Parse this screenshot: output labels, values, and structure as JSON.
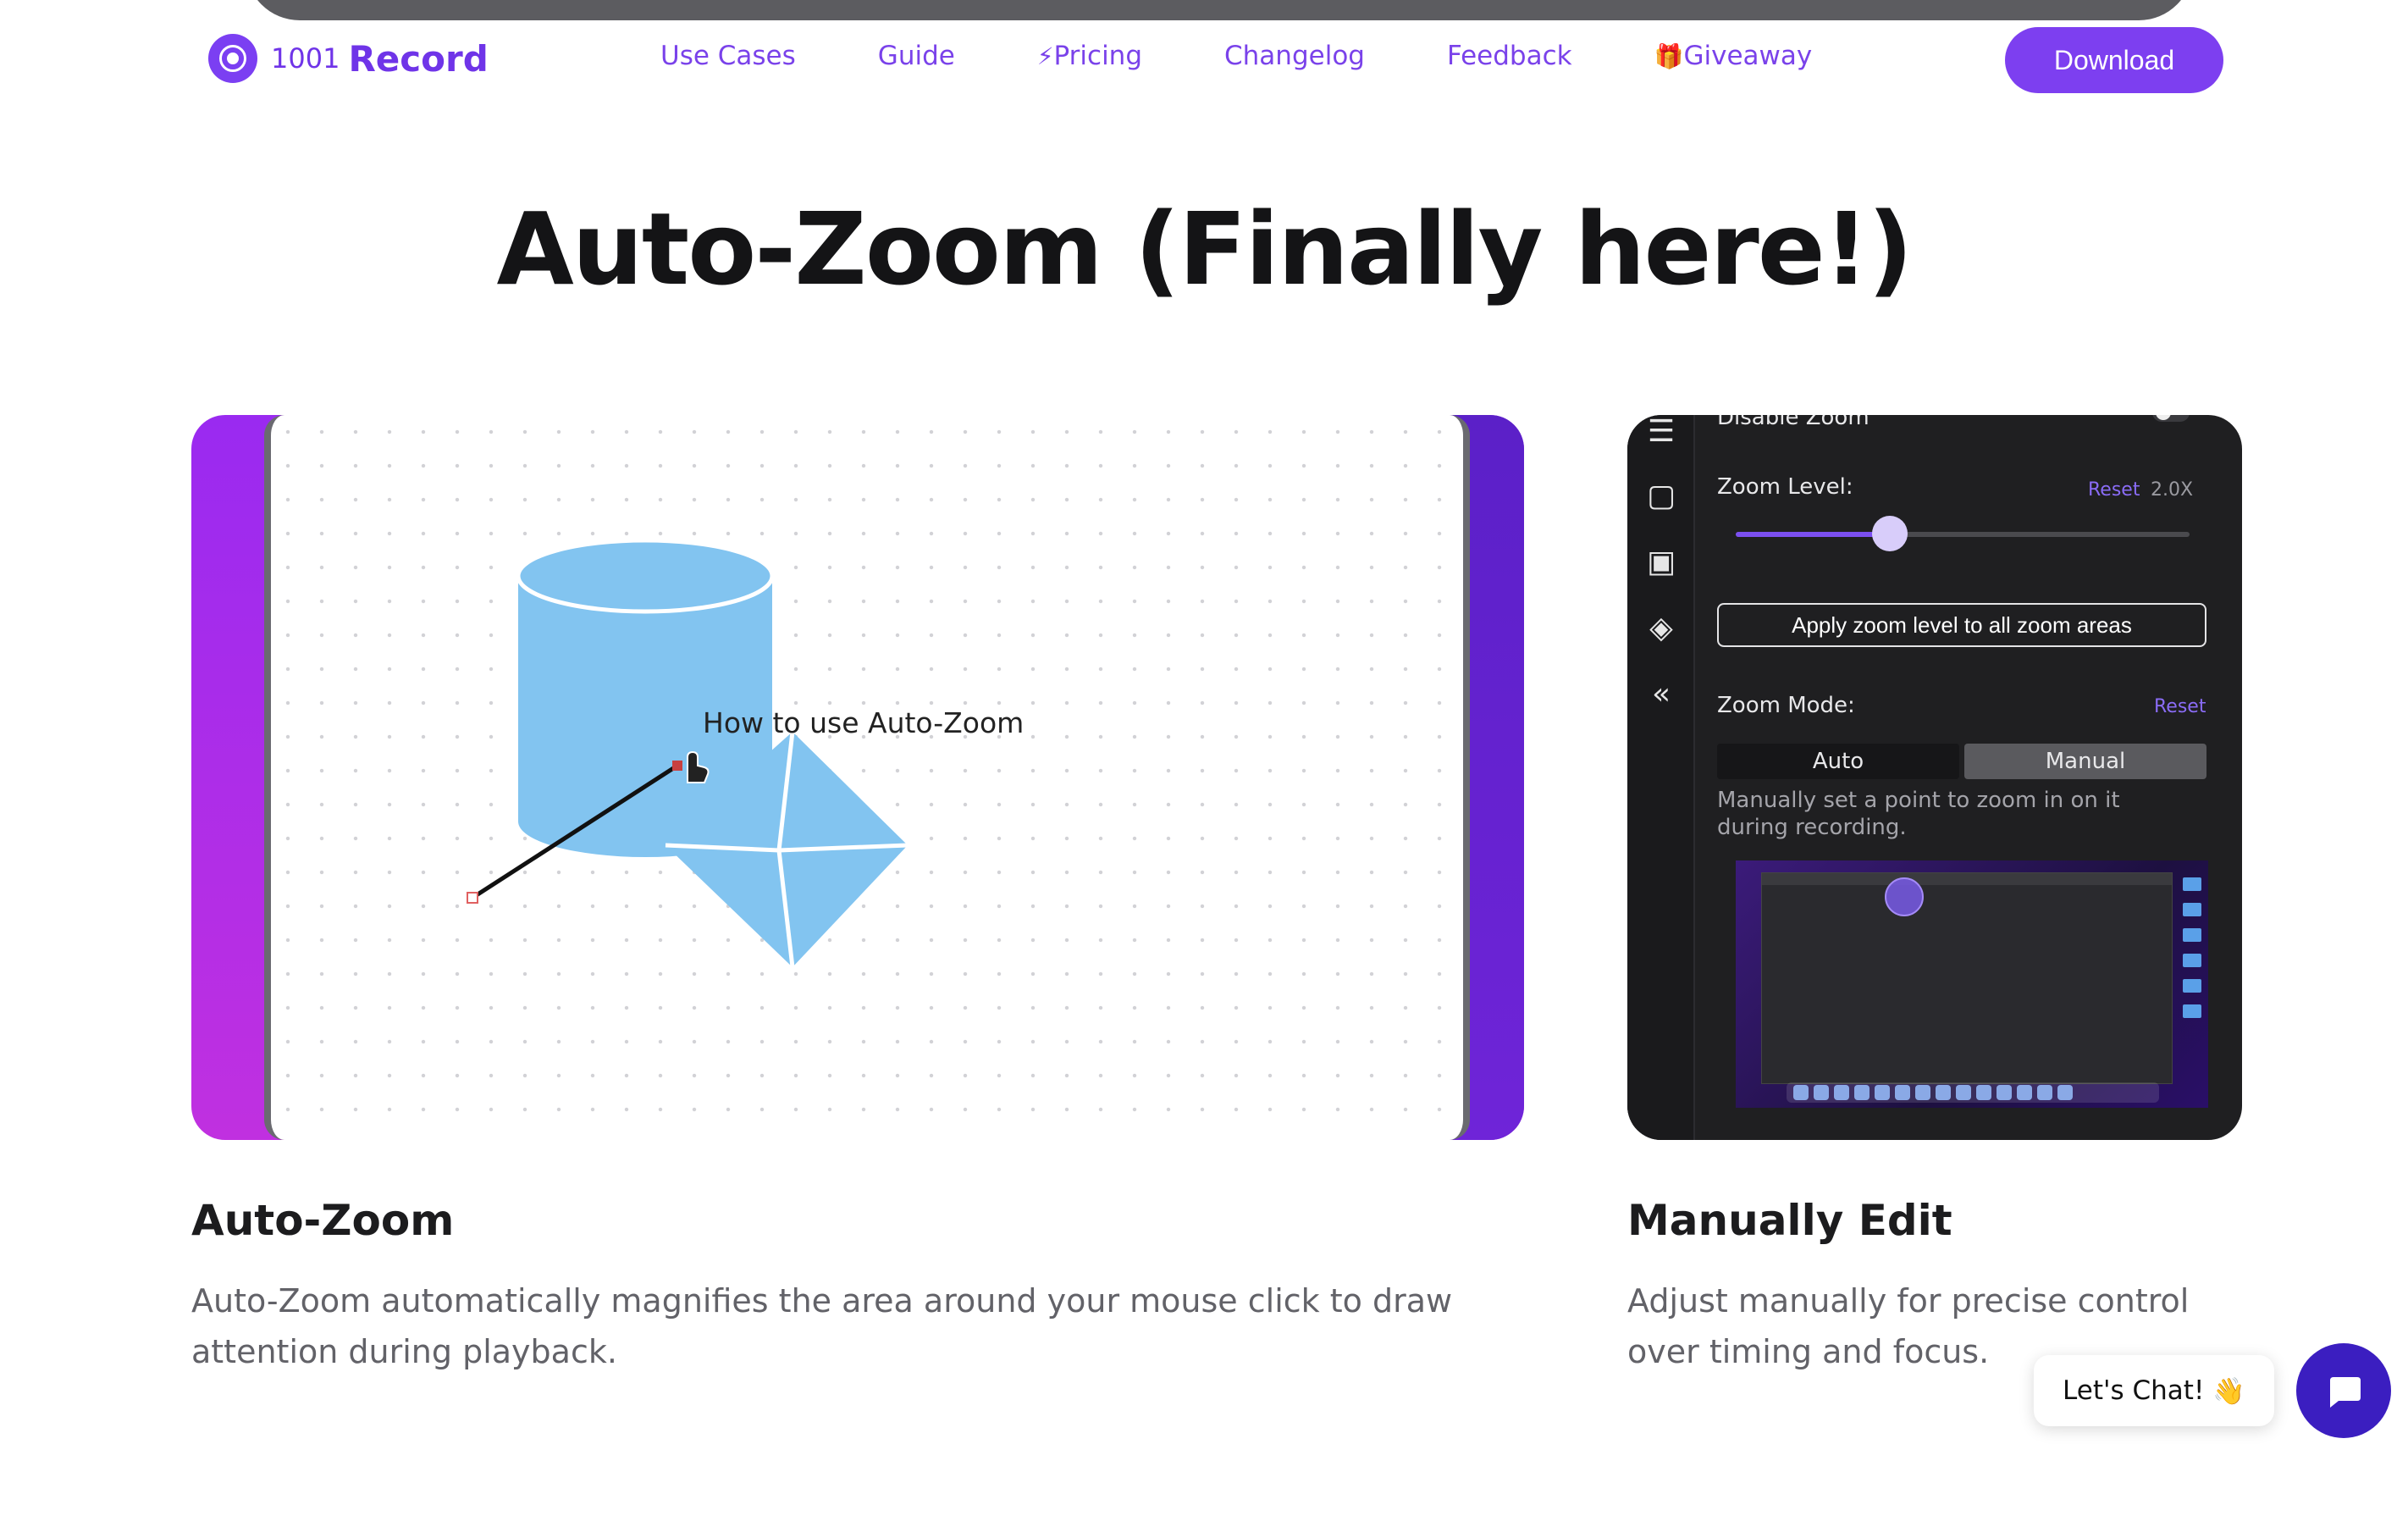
{
  "nav": {
    "logo_number": "1001",
    "logo_name": "Record",
    "links": [
      {
        "label": "Use Cases",
        "emoji": ""
      },
      {
        "label": "Guide",
        "emoji": ""
      },
      {
        "label": "Pricing",
        "emoji": "⚡"
      },
      {
        "label": "Changelog",
        "emoji": ""
      },
      {
        "label": "Feedback",
        "emoji": ""
      },
      {
        "label": "Giveaway",
        "emoji": "🎁"
      }
    ],
    "download_label": "Download"
  },
  "hero": {
    "title": "Auto-Zoom (Finally here!)"
  },
  "auto_zoom_card": {
    "canvas_label": "How to use Auto-Zoom"
  },
  "settings_panel": {
    "disable_zoom_label": "Disable Zoom",
    "zoom_level_label": "Zoom Level:",
    "zoom_level_reset": "Reset",
    "zoom_level_value": "2.0X",
    "zoom_level_fraction": 0.34,
    "apply_button_label": "Apply zoom level to all zoom areas",
    "zoom_mode_label": "Zoom Mode:",
    "zoom_mode_reset": "Reset",
    "mode_options": [
      "Auto",
      "Manual"
    ],
    "selected_mode": "Manual",
    "mode_description_line1": "Manually set a point to zoom in on it",
    "mode_description_line2": "during recording.",
    "accent_color": "#7b4ff0"
  },
  "features": [
    {
      "title": "Auto-Zoom",
      "description_line1": "Auto-Zoom automatically magnifies the area around your mouse click to draw",
      "description_line2": "attention during playback."
    },
    {
      "title": "Manually Edit",
      "description_line1": "Adjust manually for precise control",
      "description_line2": "over timing and focus."
    }
  ],
  "chat": {
    "label": "Let's Chat!",
    "emoji": "👋"
  },
  "colors": {
    "brand_purple": "#7d3ff0",
    "chat_button": "#3b1ec0"
  }
}
